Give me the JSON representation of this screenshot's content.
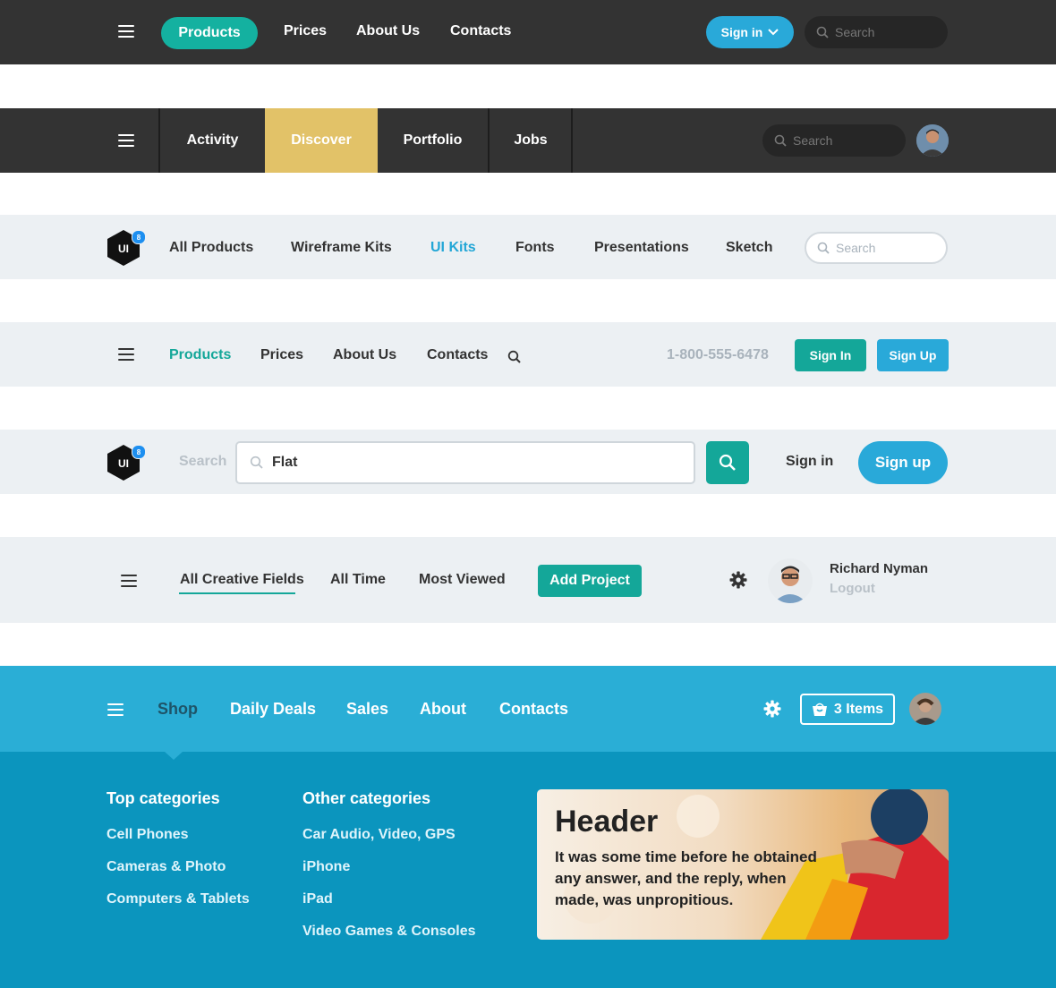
{
  "bar1": {
    "nav": [
      "Products",
      "Prices",
      "About Us",
      "Contacts"
    ],
    "signin": "Sign in",
    "search_placeholder": "Search",
    "colors": {
      "bg": "#333333",
      "active": "#14b1a0",
      "signin": "#29a9d9",
      "search_bg": "#262626"
    }
  },
  "bar2": {
    "tabs": [
      "Activity",
      "Discover",
      "Portfolio",
      "Jobs"
    ],
    "search_placeholder": "Search",
    "colors": {
      "active": "#e2c268"
    }
  },
  "bar3": {
    "logo_text": "UI",
    "logo_badge": "8",
    "nav": [
      "All Products",
      "Wireframe Kits",
      "UI Kits",
      "Fonts",
      "Presentations",
      "Sketch"
    ],
    "search_placeholder": "Search",
    "colors": {
      "active": "#22a6d6"
    }
  },
  "bar4": {
    "nav": [
      "Products",
      "Prices",
      "About Us",
      "Contacts"
    ],
    "phone": "1-800-555-6478",
    "signin": "Sign In",
    "signup": "Sign Up",
    "colors": {
      "active": "#14a799",
      "signin": "#14a799",
      "signup": "#29a9d9"
    }
  },
  "bar5": {
    "logo_text": "UI",
    "logo_badge": "8",
    "search_label": "Search",
    "search_value": "Flat",
    "signin": "Sign in",
    "signup": "Sign up",
    "colors": {
      "search_btn": "#14a799",
      "signup": "#29a9d9"
    }
  },
  "bar6": {
    "nav": [
      "All Creative Fields",
      "All Time",
      "Most Viewed"
    ],
    "add_project": "Add Project",
    "user_name": "Richard Nyman",
    "logout": "Logout",
    "colors": {
      "underline": "#14a799",
      "button": "#14a799"
    }
  },
  "bar7": {
    "nav": [
      "Shop",
      "Daily Deals",
      "Sales",
      "About",
      "Contacts"
    ],
    "cart": "3 Items",
    "colors": {
      "bg": "#2aaed6",
      "active_text": "#1e5468"
    }
  },
  "mega": {
    "top_title": "Top categories",
    "top_items": [
      "Cell Phones",
      "Cameras & Photo",
      "Computers & Tablets"
    ],
    "other_title": "Other categories",
    "other_items": [
      "Car Audio, Video, GPS",
      "iPhone",
      "iPad",
      "Video Games & Consoles"
    ],
    "card_title": "Header",
    "card_text": "It was some time before he obtained any answer, and the reply, when made, was unpropitious.",
    "colors": {
      "bg": "#0b95be"
    }
  }
}
